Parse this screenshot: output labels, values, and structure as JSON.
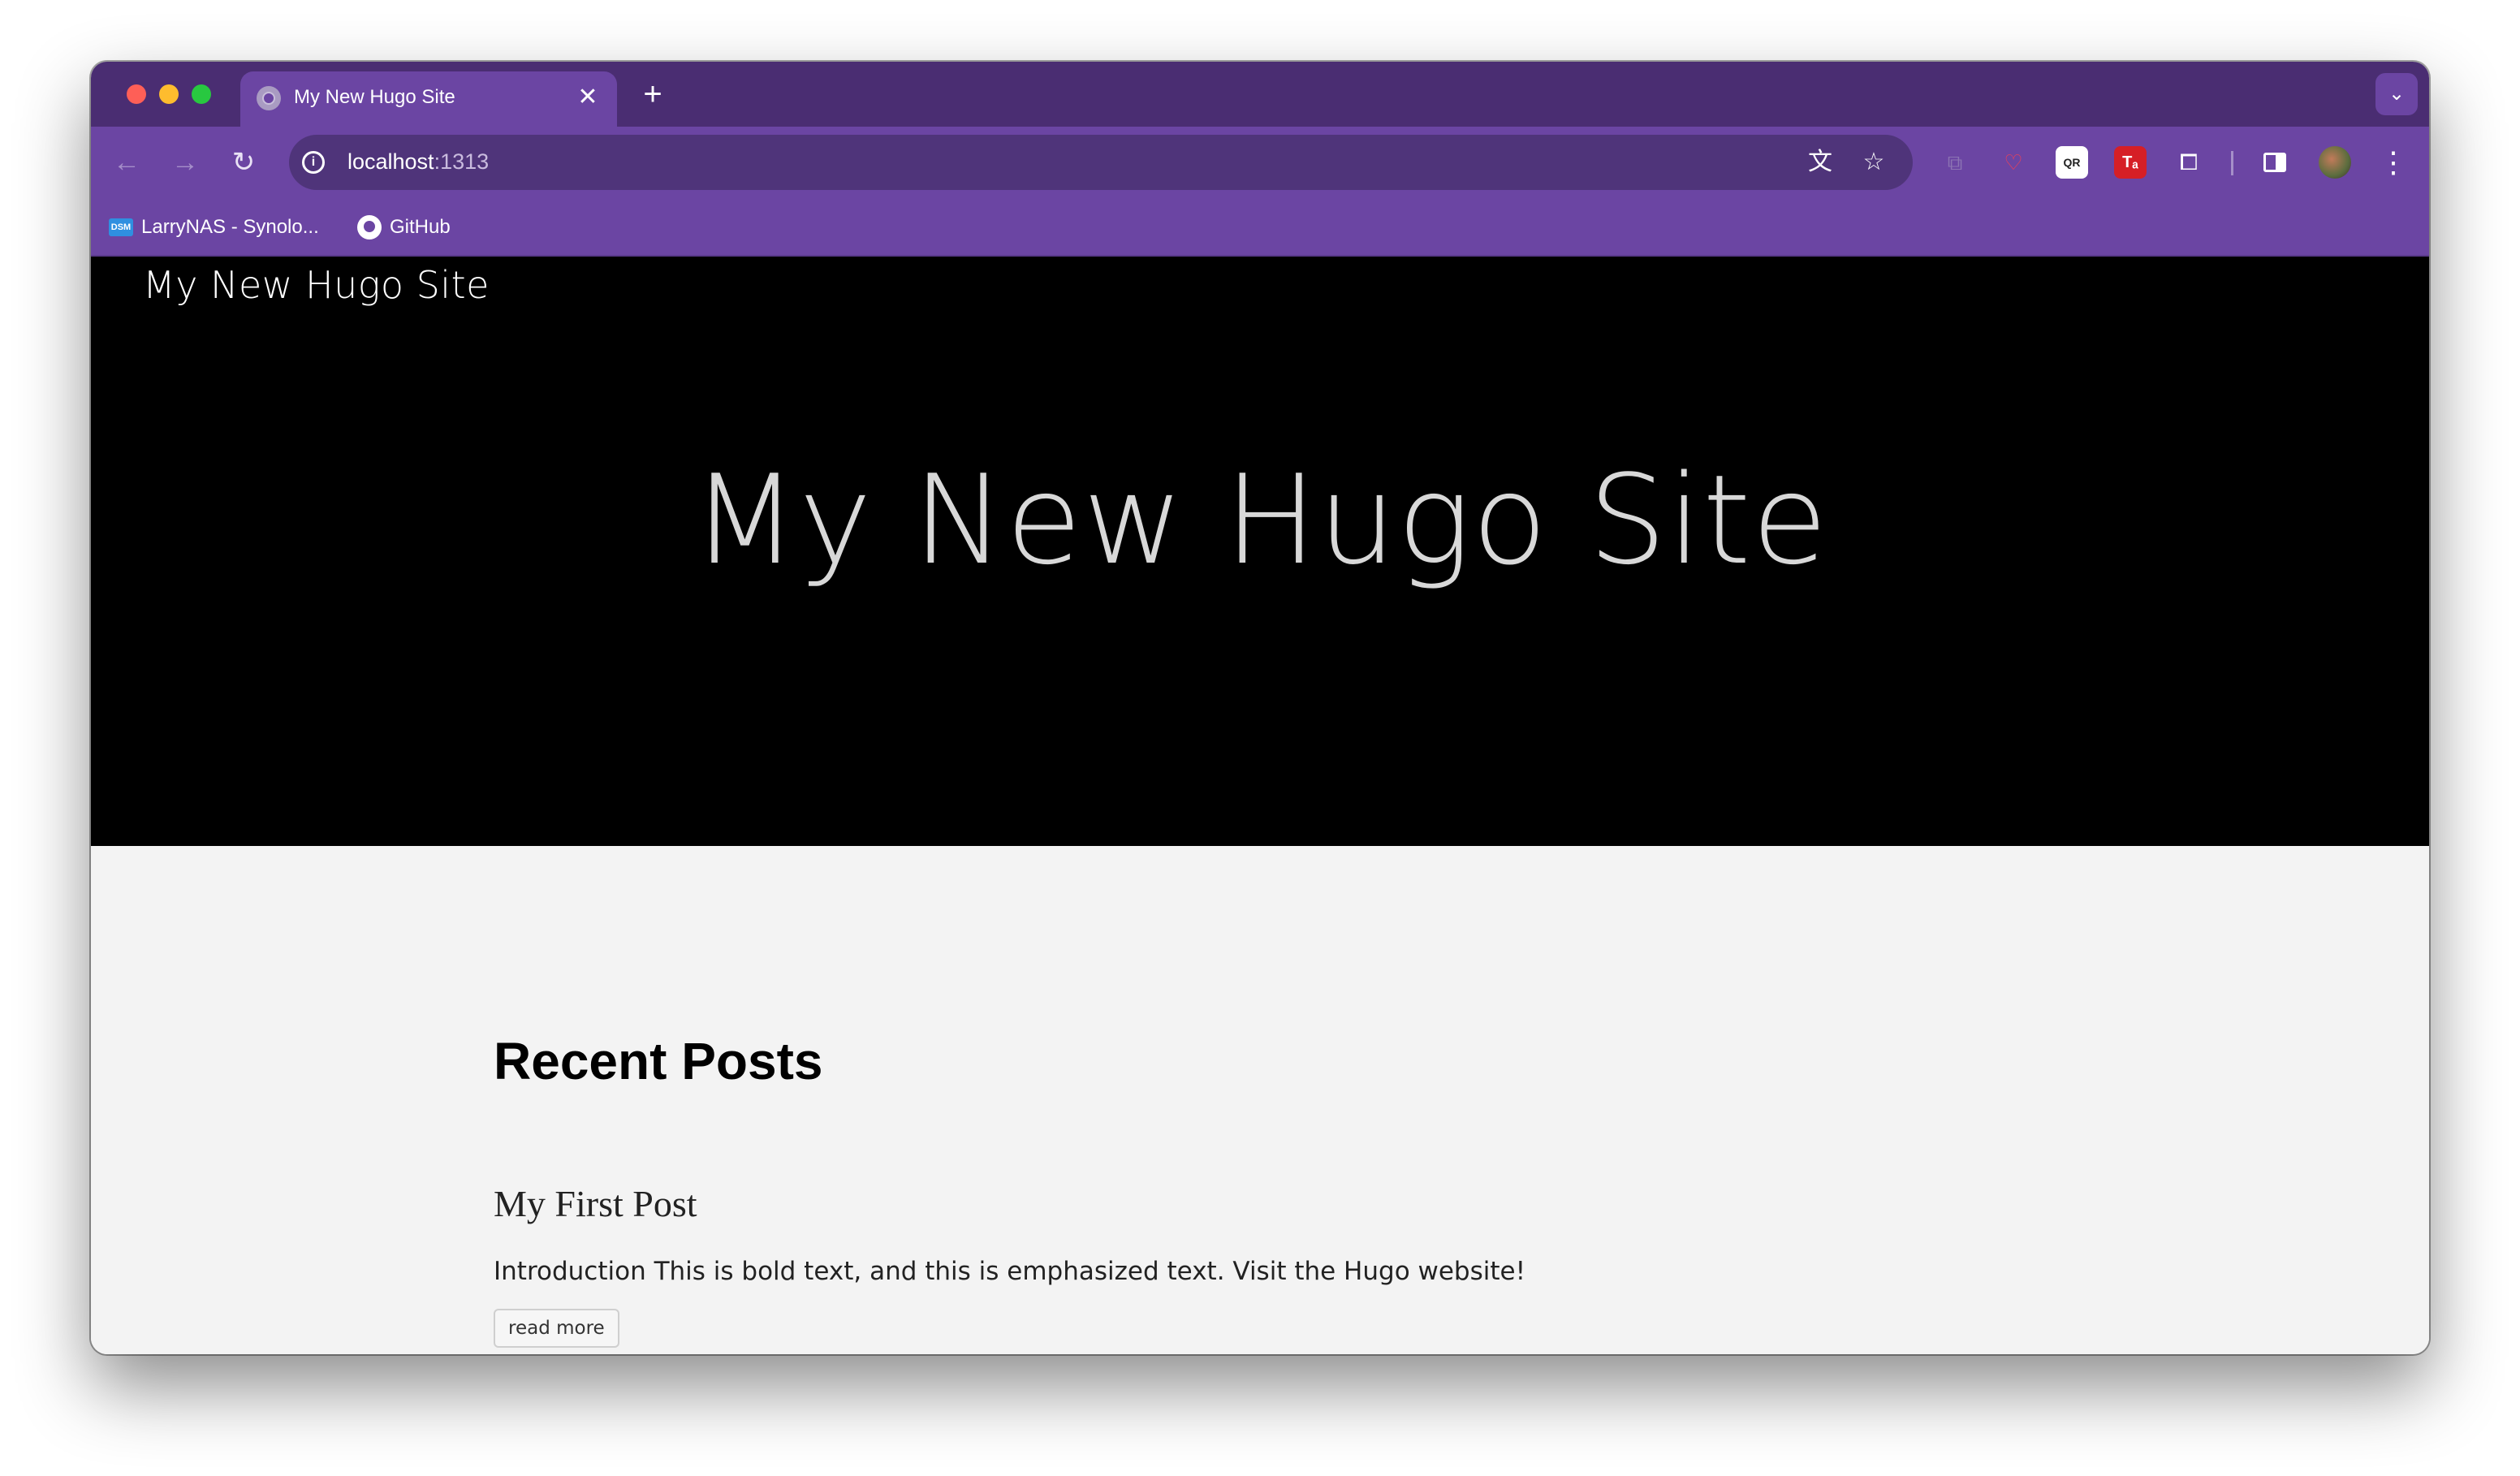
{
  "browser": {
    "tab": {
      "title": "My New Hugo Site",
      "favicon": "globe-icon",
      "close_glyph": "✕"
    },
    "new_tab_glyph": "+",
    "tab_search_glyph": "⌄",
    "nav": {
      "back_glyph": "←",
      "forward_glyph": "→",
      "reload_glyph": "↻"
    },
    "address": {
      "host": "localhost",
      "port": ":1313",
      "info_glyph": "i"
    },
    "omnibox_icons": {
      "translate_glyph": "文",
      "star_glyph": "☆"
    },
    "extensions": [
      {
        "name": "copy-icon",
        "glyph": "⧉"
      },
      {
        "name": "pocket-icon",
        "glyph": "♡"
      },
      {
        "name": "qr-code-icon",
        "glyph": "QR"
      },
      {
        "name": "ta-extension-icon",
        "glyph": "Tₐ"
      },
      {
        "name": "puzzle-icon",
        "glyph": "⧠"
      }
    ],
    "menu_glyph": "⋮",
    "bookmarks": [
      {
        "label": "LarryNAS - Synolo...",
        "icon_text": "DSM"
      },
      {
        "label": "GitHub"
      }
    ],
    "colors": {
      "tabstrip": "#4a2d72",
      "toolbar": "#6b45a3",
      "omnibox": "#4f347a"
    }
  },
  "site": {
    "brand": "My New Hugo Site",
    "hero_title": "My New Hugo Site",
    "recent_heading": "Recent Posts",
    "posts": [
      {
        "title": "My First Post",
        "summary": "Introduction This is bold text, and this is emphasized text. Visit the Hugo website!",
        "read_more_label": "read more"
      }
    ]
  }
}
